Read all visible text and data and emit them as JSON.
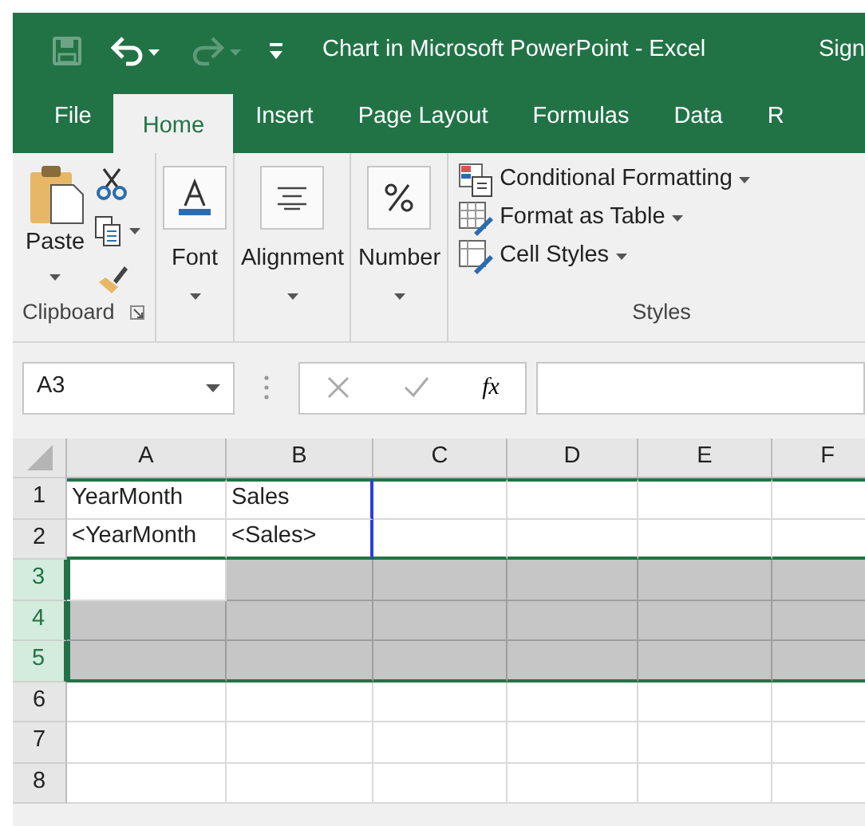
{
  "title_bar": {
    "title": "Chart in Microsoft PowerPoint  -  Excel",
    "sign_in": "Sign"
  },
  "tabs": [
    {
      "label": "File",
      "selected": false
    },
    {
      "label": "Home",
      "selected": true
    },
    {
      "label": "Insert",
      "selected": false
    },
    {
      "label": "Page Layout",
      "selected": false
    },
    {
      "label": "Formulas",
      "selected": false
    },
    {
      "label": "Data",
      "selected": false
    },
    {
      "label": "R",
      "selected": false
    }
  ],
  "ribbon": {
    "clipboard": {
      "paste": "Paste",
      "label": "Clipboard"
    },
    "big_buttons": [
      {
        "kind": "font",
        "label": "Font"
      },
      {
        "kind": "alignment",
        "label": "Alignment"
      },
      {
        "kind": "number",
        "label": "Number"
      }
    ],
    "styles": {
      "items": [
        {
          "kind": "conditional",
          "label": "Conditional Formatting"
        },
        {
          "kind": "table",
          "label": "Format as Table"
        },
        {
          "kind": "cellstyles",
          "label": "Cell Styles"
        }
      ],
      "label": "Styles"
    }
  },
  "formula_bar": {
    "name_box": "A3",
    "fx": "fx"
  },
  "grid": {
    "columns": [
      "A",
      "B",
      "C",
      "D",
      "E",
      "F"
    ],
    "rows": [
      {
        "header": "1",
        "selected": false,
        "cells": [
          {
            "text": "YearMonth"
          },
          {
            "text": "Sales"
          }
        ]
      },
      {
        "header": "2",
        "selected": false,
        "cells": [
          {
            "text": "<YearMonth"
          },
          {
            "text": "<Sales>"
          }
        ]
      },
      {
        "header": "3",
        "selected": true,
        "cells": [
          {
            "active": true
          },
          {
            "active": false
          },
          {
            "active": false
          },
          {
            "active": false
          },
          {
            "active": false
          },
          {
            "active": false
          }
        ]
      },
      {
        "header": "4",
        "selected": true,
        "cells": [
          {
            "active": false
          },
          {
            "active": false
          },
          {
            "active": false
          },
          {
            "active": false
          },
          {
            "active": false
          },
          {
            "active": false
          }
        ]
      },
      {
        "header": "5",
        "selected": true,
        "cells": [
          {
            "active": false
          },
          {
            "active": false
          },
          {
            "active": false
          },
          {
            "active": false
          },
          {
            "active": false
          },
          {
            "active": false
          }
        ]
      },
      {
        "header": "6",
        "selected": false
      },
      {
        "header": "7",
        "selected": false
      },
      {
        "header": "8",
        "selected": false
      }
    ]
  }
}
